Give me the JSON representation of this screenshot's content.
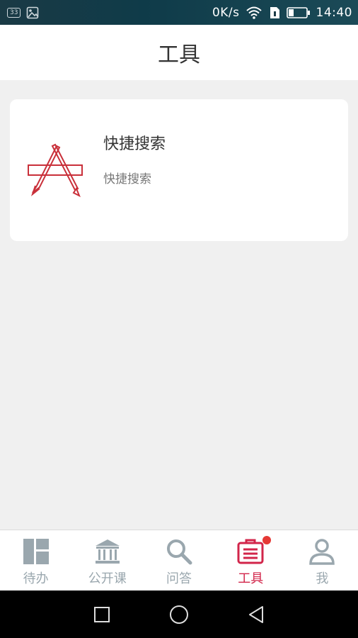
{
  "statusbar": {
    "sim_label": "33",
    "speed": "0K/s",
    "time": "14:40"
  },
  "header": {
    "title": "工具"
  },
  "tools": [
    {
      "title": "快捷搜索",
      "description": "快捷搜索",
      "icon": "app-store-icon"
    }
  ],
  "bottom_nav": {
    "items": [
      {
        "label": "待办",
        "icon": "dashboard-icon",
        "active": false
      },
      {
        "label": "公开课",
        "icon": "bank-icon",
        "active": false
      },
      {
        "label": "问答",
        "icon": "search-icon",
        "active": false
      },
      {
        "label": "工具",
        "icon": "toolbox-icon",
        "active": true,
        "badge": true
      },
      {
        "label": "我",
        "icon": "person-icon",
        "active": false
      }
    ]
  },
  "colors": {
    "accent": "#d2254a",
    "inactive": "#9aa7ae",
    "background": "#f0f0f0"
  }
}
